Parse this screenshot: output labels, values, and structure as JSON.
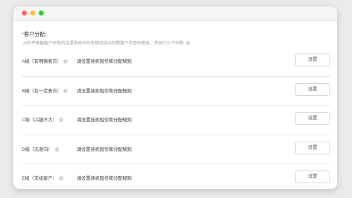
{
  "section": {
    "required_mark": "*",
    "title": "客户分配:",
    "description": "AI外呼根据客户回答的话语和命中的关键词自动判断客户的意向等级，并执行以下分配"
  },
  "rows": [
    {
      "label": "A级（有明确意向）",
      "hint": "请设置挂机短信和分配规则",
      "button": "设置"
    },
    {
      "label": "B级（有一定意向）",
      "hint": "请设置挂机短信和分配规则",
      "button": "设置"
    },
    {
      "label": "C级（兴趣不大）",
      "hint": "请设置挂机短信和分配规则",
      "button": "设置"
    },
    {
      "label": "D级（无意向）",
      "hint": "请设置挂机短信和分配规则",
      "button": "设置"
    },
    {
      "label": "E级（未接客户）",
      "hint": "请设置挂机短信和分配规则",
      "button": "设置"
    }
  ],
  "icons": {
    "help": "question-circle-icon",
    "help_glyph": "?"
  },
  "colors": {
    "required": "#e54545",
    "close": "#fe5f57",
    "minimize": "#febc2e",
    "zoom": "#28c840"
  }
}
